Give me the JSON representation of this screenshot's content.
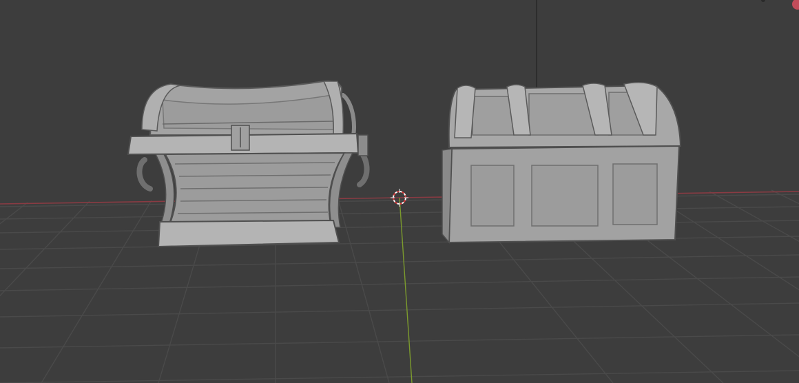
{
  "viewport": {
    "mode": "3D Viewport",
    "background": "#3d3d3d",
    "grid_color": "#4a4a4a",
    "x_axis_color": "#8a3b43",
    "y_axis_color": "#7c9b2d",
    "z_axis_color": "#2b2b2b",
    "cursor_icon": "3d-cursor-icon",
    "gizmo_icon": "navigation-gizmo-icon"
  },
  "objects": [
    {
      "name": "treasure-chest-curved",
      "color": "#a6a6a6"
    },
    {
      "name": "treasure-chest-boxy",
      "color": "#a6a6a6"
    }
  ]
}
